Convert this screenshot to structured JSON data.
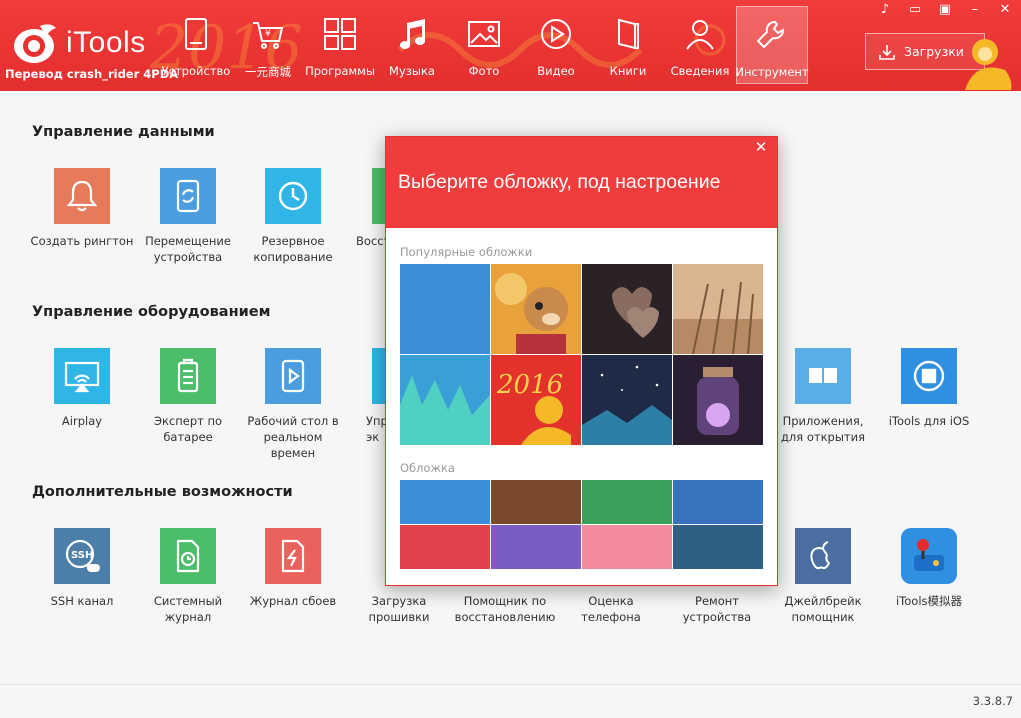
{
  "app": {
    "name": "iTools",
    "translator": "Перевод crash_rider 4PDA",
    "version": "3.3.8.7"
  },
  "nav": [
    {
      "label": "Устройство",
      "icon": "device-icon"
    },
    {
      "label": "一元商城",
      "icon": "cart-icon"
    },
    {
      "label": "Программы",
      "icon": "apps-icon"
    },
    {
      "label": "Музыка",
      "icon": "music-icon"
    },
    {
      "label": "Фото",
      "icon": "photo-icon"
    },
    {
      "label": "Видео",
      "icon": "video-icon"
    },
    {
      "label": "Книги",
      "icon": "book-icon"
    },
    {
      "label": "Сведения",
      "icon": "user-icon"
    },
    {
      "label": "Инструмент",
      "icon": "wrench-icon",
      "active": true
    }
  ],
  "header": {
    "downloads_label": "Загрузки"
  },
  "sections": {
    "data": "Управление данными",
    "hardware": "Управление оборудованием",
    "extra": "Дополнительные возможности"
  },
  "tools": {
    "ringtone": "Создать рингтон",
    "migration": "Перемещение устройства",
    "backup": "Резервное копирование",
    "restore": "Восст",
    "airplay": "Airplay",
    "battery": "Эксперт по батарее",
    "desktop": "Рабочий стол в реальном времен",
    "manage": "Упр эк",
    "apps_open": "Приложения, для открытия",
    "itools_ios": "iTools для iOS",
    "ssh": "SSH канал",
    "syslog": "Системный журнал",
    "crashlog": "Журнал сбоев",
    "firmware": "Загрузка прошивки",
    "recovery": "Помощник по восстановлению",
    "phone_eval": "Оценка телефона",
    "repair": "Ремонт устройства",
    "jailbreak": "Джейлбрейк помощник",
    "emulator": "iTools模拟器"
  },
  "dialog": {
    "title": "Выберите обложку, под настроение",
    "popular_label": "Популярные обложки",
    "cover_label": "Обложка",
    "colors": [
      "#3c8edb",
      "#7b4a2c",
      "#3ca05a",
      "#3675be",
      "#e0434c",
      "#7b5cc4",
      "#f08a9c",
      "#2f5f82"
    ]
  },
  "colors": {
    "brand_red": "#ef3b3b",
    "tile_orange": "#e87a5c",
    "tile_blue": "#4a9ee0",
    "tile_cyan": "#2fb6e6",
    "tile_green": "#4cbe6a",
    "tile_slate": "#4b7ea8",
    "tile_red": "#e9625c"
  }
}
